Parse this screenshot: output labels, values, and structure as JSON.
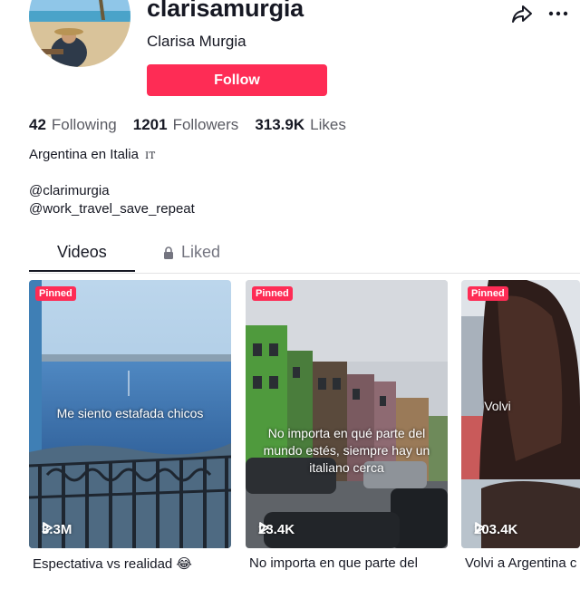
{
  "profile": {
    "username": "clarisamurgia",
    "display_name": "Clarisa Murgia",
    "follow_label": "Follow",
    "avatar_icon": "avatar-beach-photo"
  },
  "header_actions": {
    "share_icon": "share-icon",
    "more_icon": "more-icon"
  },
  "stats": {
    "following_count": "42",
    "following_label": "Following",
    "followers_count": "1201",
    "followers_label": "Followers",
    "likes_count": "313.9K",
    "likes_label": "Likes"
  },
  "bio": {
    "line1": "Argentina en Italia",
    "flag": "IT",
    "link1": "@clarimurgia",
    "link2": "@work_travel_save_repeat"
  },
  "tabs": {
    "videos": "Videos",
    "liked": "Liked",
    "liked_icon": "lock-icon",
    "active": "Videos"
  },
  "videos": [
    {
      "badge": "Pinned",
      "overlay": "Me siento estafada chicos",
      "views": "3.3M",
      "caption": "Espectativa vs realidad 😂"
    },
    {
      "badge": "Pinned",
      "overlay": "No importa en qué parte del mundo estés, siempre hay un italiano cerca",
      "views": "23.4K",
      "caption": "No importa en que parte del"
    },
    {
      "badge": "Pinned",
      "overlay": "Volvi",
      "views": "203.4K",
      "caption": "Volvi a Argentina c"
    }
  ],
  "colors": {
    "accent": "#fe2c55",
    "text": "#161823",
    "muted": "#5a5b63"
  }
}
